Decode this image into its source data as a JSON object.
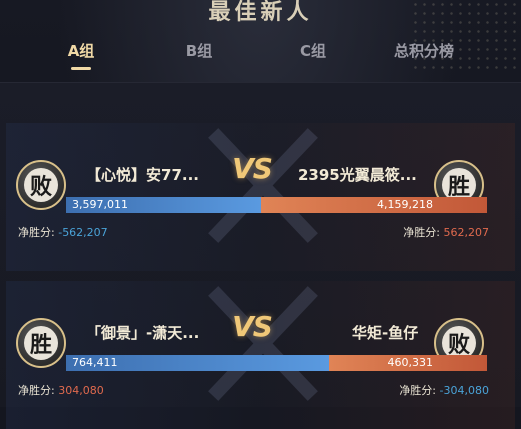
{
  "page": {
    "title": "最佳新人"
  },
  "tabs": [
    {
      "label": "A组",
      "active": true
    },
    {
      "label": "B组",
      "active": false
    },
    {
      "label": "C组",
      "active": false
    },
    {
      "label": "总积分榜",
      "active": false
    }
  ],
  "matches": [
    {
      "left": {
        "name": "【心悦】安77...",
        "result": "败",
        "score": "3,597,011",
        "net_label": "净胜分:",
        "net": "-562,207"
      },
      "right": {
        "name": "2395光翼晨筱...",
        "result": "胜",
        "score": "4,159,218",
        "net_label": "净胜分:",
        "net": "562,207"
      },
      "vs": "VS",
      "left_share": 0.464
    },
    {
      "left": {
        "name": "「御景」-潇天...",
        "result": "胜",
        "score": "764,411",
        "net_label": "净胜分:",
        "net": "304,080"
      },
      "right": {
        "name": "华矩-鱼仔",
        "result": "败",
        "score": "460,331",
        "net_label": "净胜分:",
        "net": "-304,080"
      },
      "vs": "VS",
      "left_share": 0.624
    }
  ],
  "colors": {
    "accent": "#f0d9a6",
    "left_bar": "#4a86cc",
    "right_bar": "#d46a45",
    "negative": "#4aa3d8",
    "positive": "#e06a4e"
  }
}
